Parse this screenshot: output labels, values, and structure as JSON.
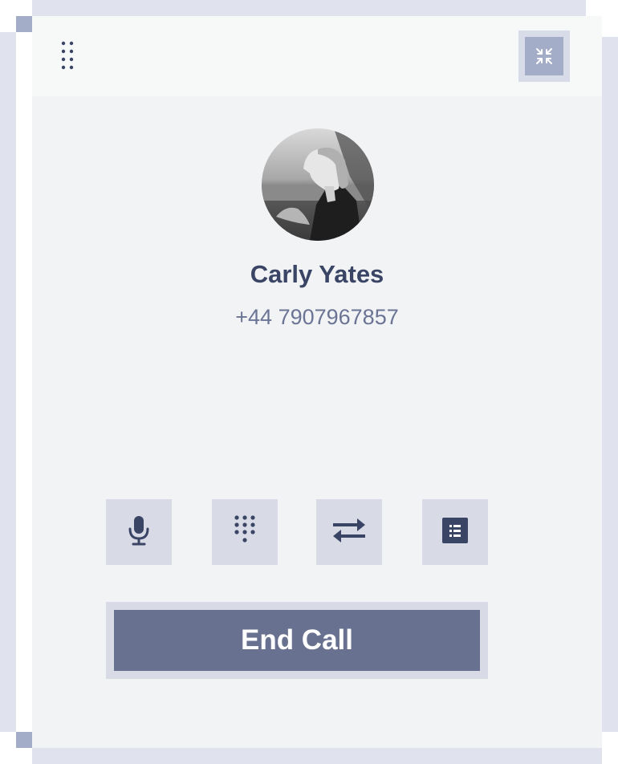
{
  "colors": {
    "frame": "#e0e3ed",
    "corner_handle": "#a3adc8",
    "panel_background": "#f2f3f5",
    "header_background": "#f7f8f8",
    "control_background": "#d8dbe6",
    "icon": "#3a4566",
    "end_call_button": "#68718f",
    "end_call_text": "#ffffff"
  },
  "header": {
    "drag_icon": "drag-dots-icon",
    "minimize_icon": "compress-arrows-icon"
  },
  "caller": {
    "name": "Carly Yates",
    "number": "+44 7907967857",
    "avatar": "profile-photo"
  },
  "controls": [
    {
      "name": "mute",
      "icon": "microphone-icon"
    },
    {
      "name": "dialpad",
      "icon": "dialpad-icon"
    },
    {
      "name": "transfer",
      "icon": "transfer-arrows-icon"
    },
    {
      "name": "notes",
      "icon": "list-document-icon"
    }
  ],
  "end_call": {
    "label": "End Call"
  }
}
